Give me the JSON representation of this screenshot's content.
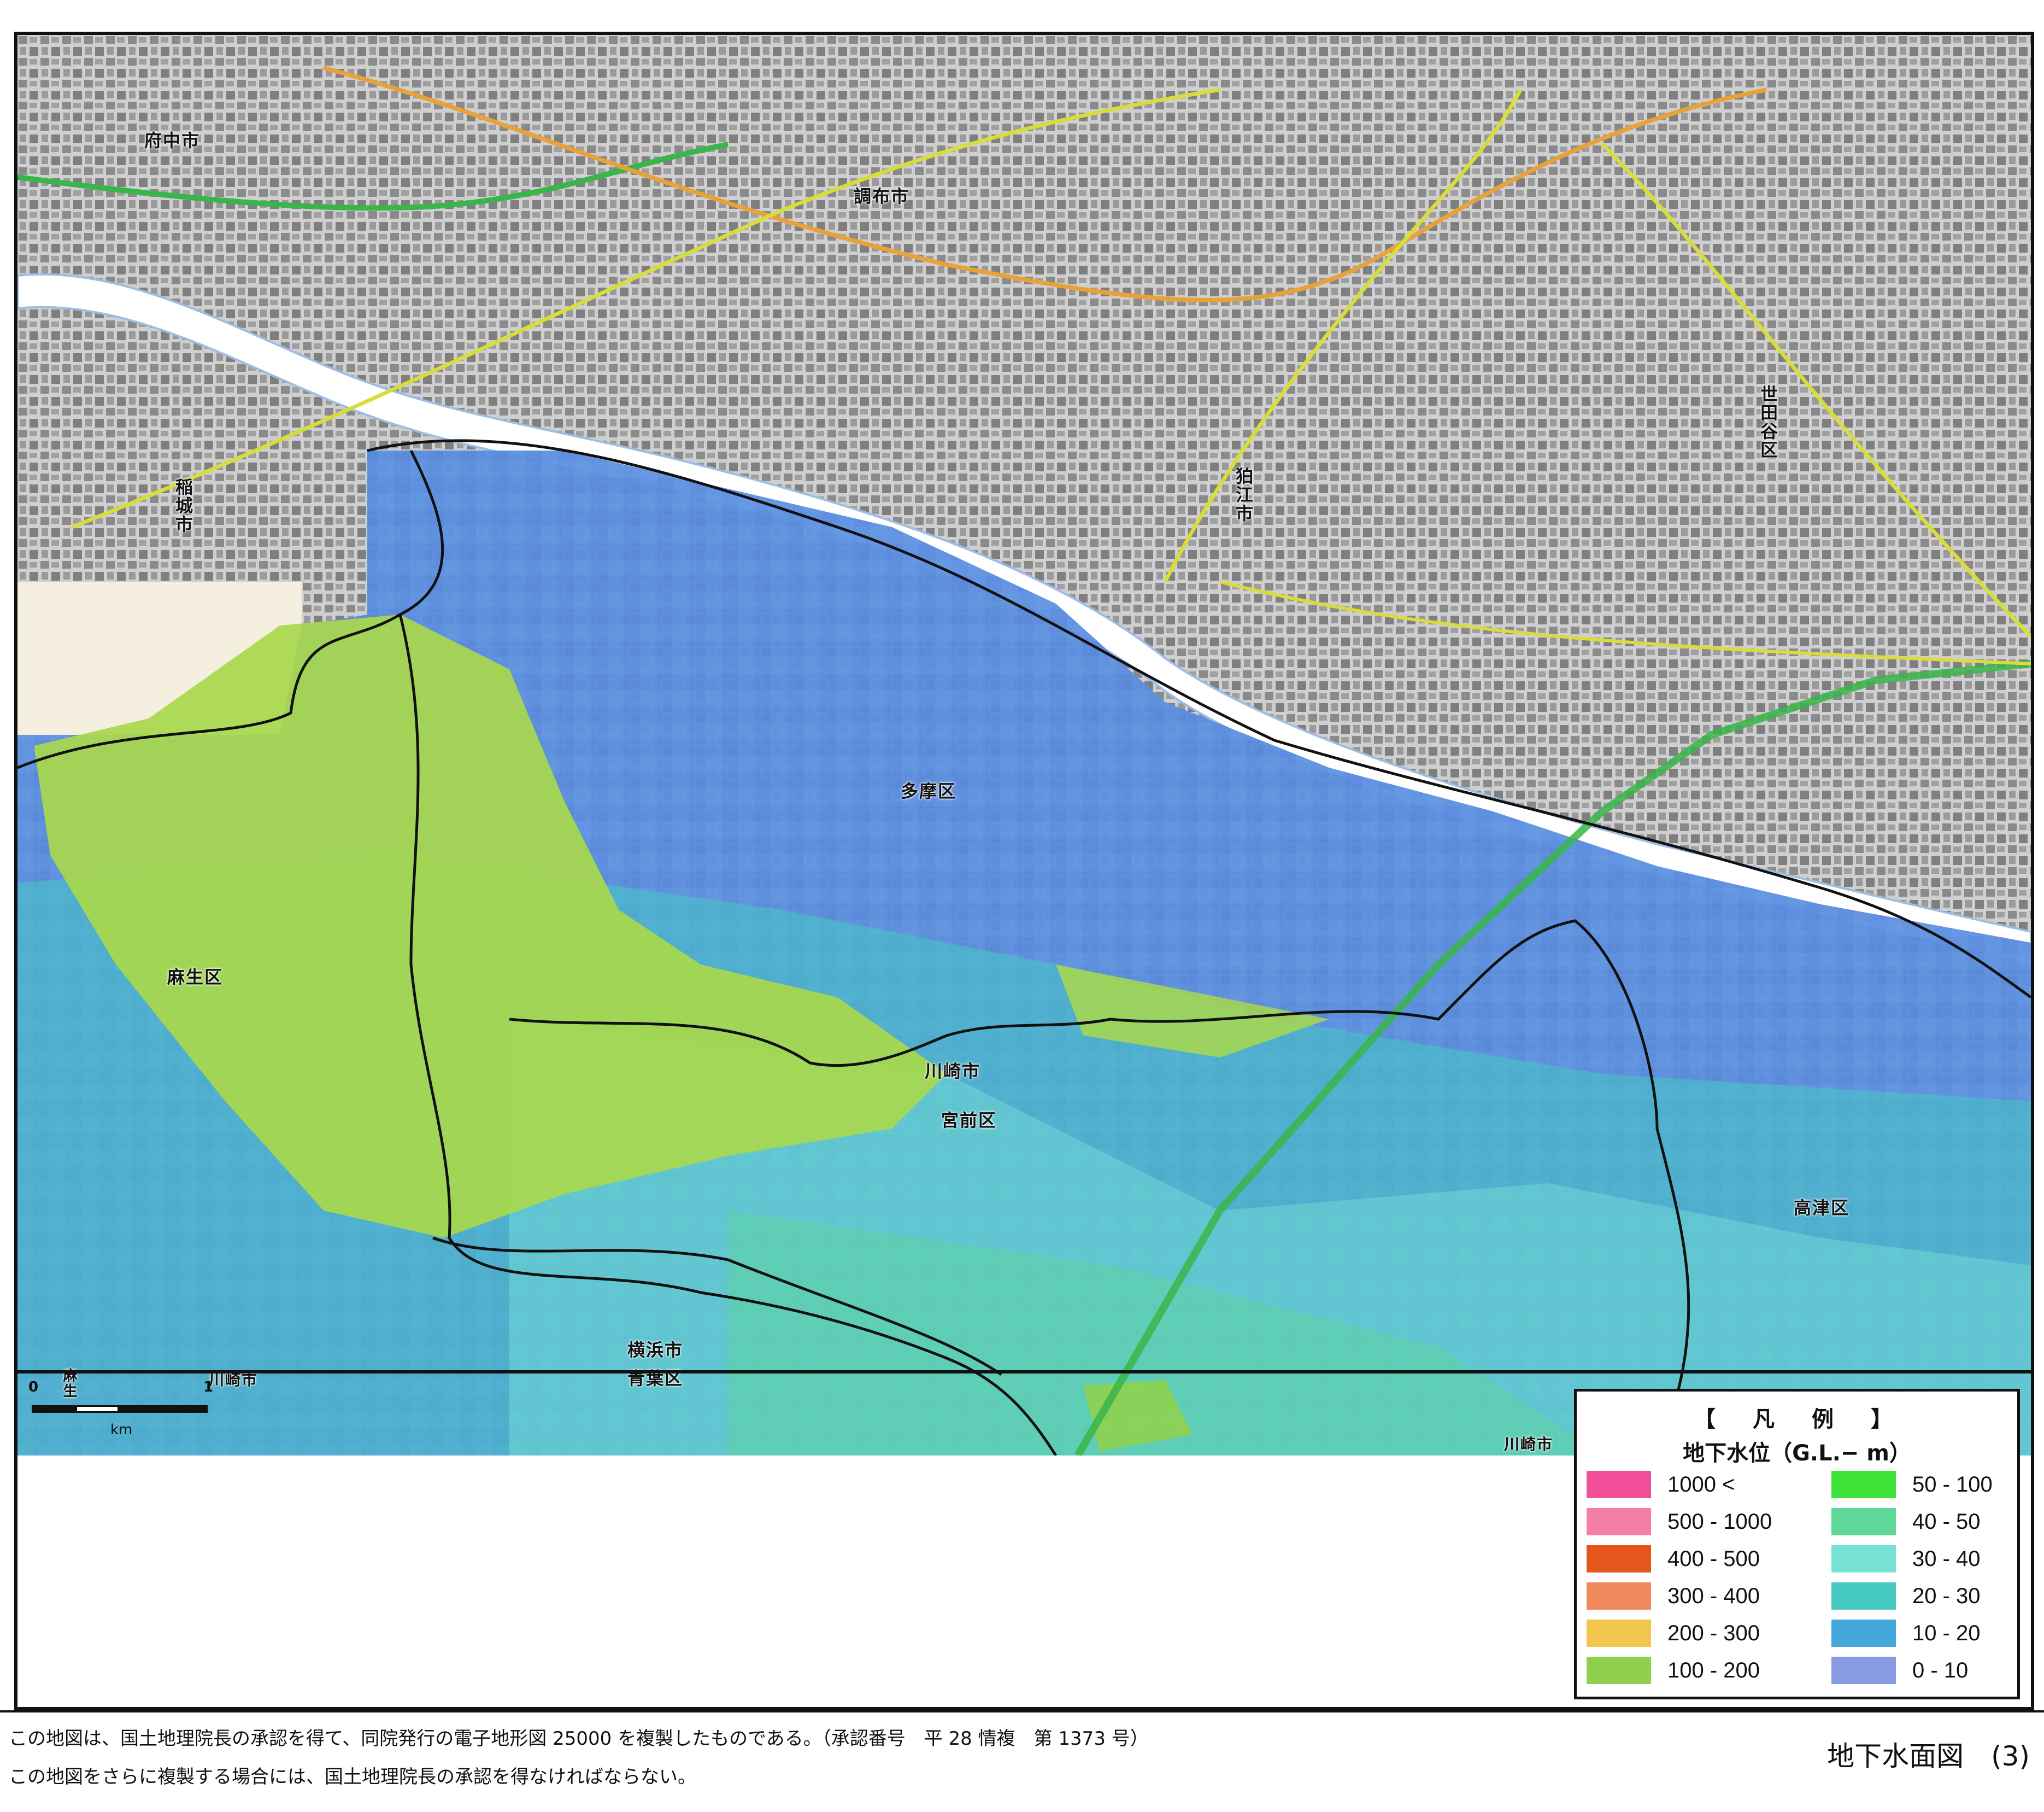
{
  "map": {
    "places": [
      {
        "id": "fuchu",
        "name": "府中市"
      },
      {
        "id": "chofu",
        "name": "調布市"
      },
      {
        "id": "setagaya",
        "name": "世田谷区"
      },
      {
        "id": "inagi",
        "name": "稲城市"
      },
      {
        "id": "komae",
        "name": "狛江市"
      },
      {
        "id": "tama",
        "name": "多摩区"
      },
      {
        "id": "asao",
        "name": "麻生区"
      },
      {
        "id": "kawasaki",
        "name": "川崎市"
      },
      {
        "id": "miyamae",
        "name": "宮前区"
      },
      {
        "id": "takatsu",
        "name": "高津区"
      },
      {
        "id": "yokohama",
        "name": "横浜市"
      },
      {
        "id": "aoba",
        "name": "青葉区"
      },
      {
        "id": "asao-bottom",
        "name": "麻生"
      },
      {
        "id": "kawasaki-bottom",
        "name": "川崎市"
      },
      {
        "id": "kawasaki-bottom-right",
        "name": "川崎市"
      }
    ],
    "colors": {
      "base_map": "#d9d9d9",
      "river": "#ffffff",
      "rail": "#3ab54a",
      "road_major": "#e8a23a",
      "road_minor": "#d8dd3a",
      "boundary": "#111111"
    }
  },
  "scale": {
    "zero": "0",
    "one": "1",
    "unit": "km"
  },
  "legend": {
    "title": "【　凡　例　】",
    "subtitle": "地下水位（G.L.− m）",
    "items": [
      {
        "label": "1000 <",
        "color": "#f24f9a"
      },
      {
        "label": "500 - 1000",
        "color": "#f47fa6"
      },
      {
        "label": "400 - 500",
        "color": "#e5561d"
      },
      {
        "label": "300 - 400",
        "color": "#ee8a5c"
      },
      {
        "label": "200 - 300",
        "color": "#f3c64d"
      },
      {
        "label": "100 - 200",
        "color": "#8fd14f"
      },
      {
        "label": "50 - 100",
        "color": "#3fe43a"
      },
      {
        "label": "40 - 50",
        "color": "#5ed897"
      },
      {
        "label": "30 - 40",
        "color": "#76e2d4"
      },
      {
        "label": "20 - 30",
        "color": "#45c9c1"
      },
      {
        "label": "10 - 20",
        "color": "#44a8dc"
      },
      {
        "label": "0 - 10",
        "color": "#8a9be6"
      }
    ]
  },
  "footer": {
    "note1": "この地図は、国土地理院長の承認を得て、同院発行の電子地形図 25000 を複製したものである。（承認番号　平 28 情複　第 1373 号）",
    "note2": "この地図をさらに複製する場合には、国土地理院長の承認を得なければならない。",
    "sheet_title": "地下水面図　(3)"
  }
}
